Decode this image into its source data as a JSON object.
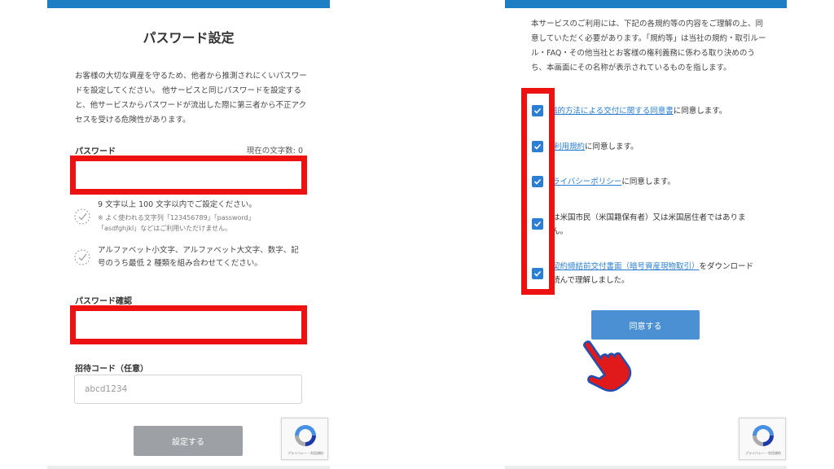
{
  "left_panel": {
    "title": "パスワード設定",
    "intro": "お客様の大切な資産を守るため、他者から推測されにくいパスワードを設定してください。 他サービスと同じパスワードを設定すると、他サービスからパスワードが流出した際に第三者から不正アクセスを受ける危険性があります。",
    "password_label": "パスワード",
    "char_count_label": "現在の文字数: 0",
    "password_value": "",
    "rules": [
      {
        "text": "9 文字以上 100 文字以内でご設定ください。",
        "sub": "※ よく使われる文字列「123456789」「password」「asdfghjkl」などはご利用いただけません。"
      },
      {
        "text": "アルファベット小文字、アルファベット大文字、数字、記号のうち最低 2 種類を組み合わせてください。",
        "sub": ""
      }
    ],
    "confirm_label": "パスワード確認",
    "confirm_value": "",
    "invite_label": "招待コード（任意）",
    "invite_placeholder": "abcd1234",
    "submit_label": "設定する",
    "recaptcha_text": "プライバシー・利用規約"
  },
  "right_panel": {
    "intro": "本サービスのご利用には、下記の各規約等の内容をご理解の上、同意していただく必要があります。「規約等」は当社の規約・取引ルール・FAQ・その他当社とお客様の権利義務に係わる取り決めのうち、本画面にその名称が表示されているものを指します。",
    "terms": [
      {
        "link": "磁的方法による交付に関する同意書",
        "text": "に同意します。",
        "link2": "",
        "checked": true
      },
      {
        "link": "利用規約",
        "text": "に同意します。",
        "link2": "",
        "checked": true
      },
      {
        "link": "ライバシーポリシー",
        "text": "に同意します。",
        "link2": "",
        "checked": true
      },
      {
        "link": "",
        "text": "は米国市民（米国籍保有者）又は米国居住者ではありま",
        "link2": "ん。",
        "checked": true
      },
      {
        "link": "契約締結前交付書面（暗号資産現物取引）",
        "text": "をダウンロード",
        "link2": "読んで理解しました。",
        "checked": true
      }
    ],
    "agree_label": "同意する",
    "recaptcha_text": "プライバシー・利用規約"
  },
  "colors": {
    "brand_blue": "#1d7ec4",
    "checkbox_blue": "#2a7fd4",
    "highlight_red": "#ee1111",
    "button_disabled": "#9da0a4",
    "button_primary": "#4a90d3"
  }
}
